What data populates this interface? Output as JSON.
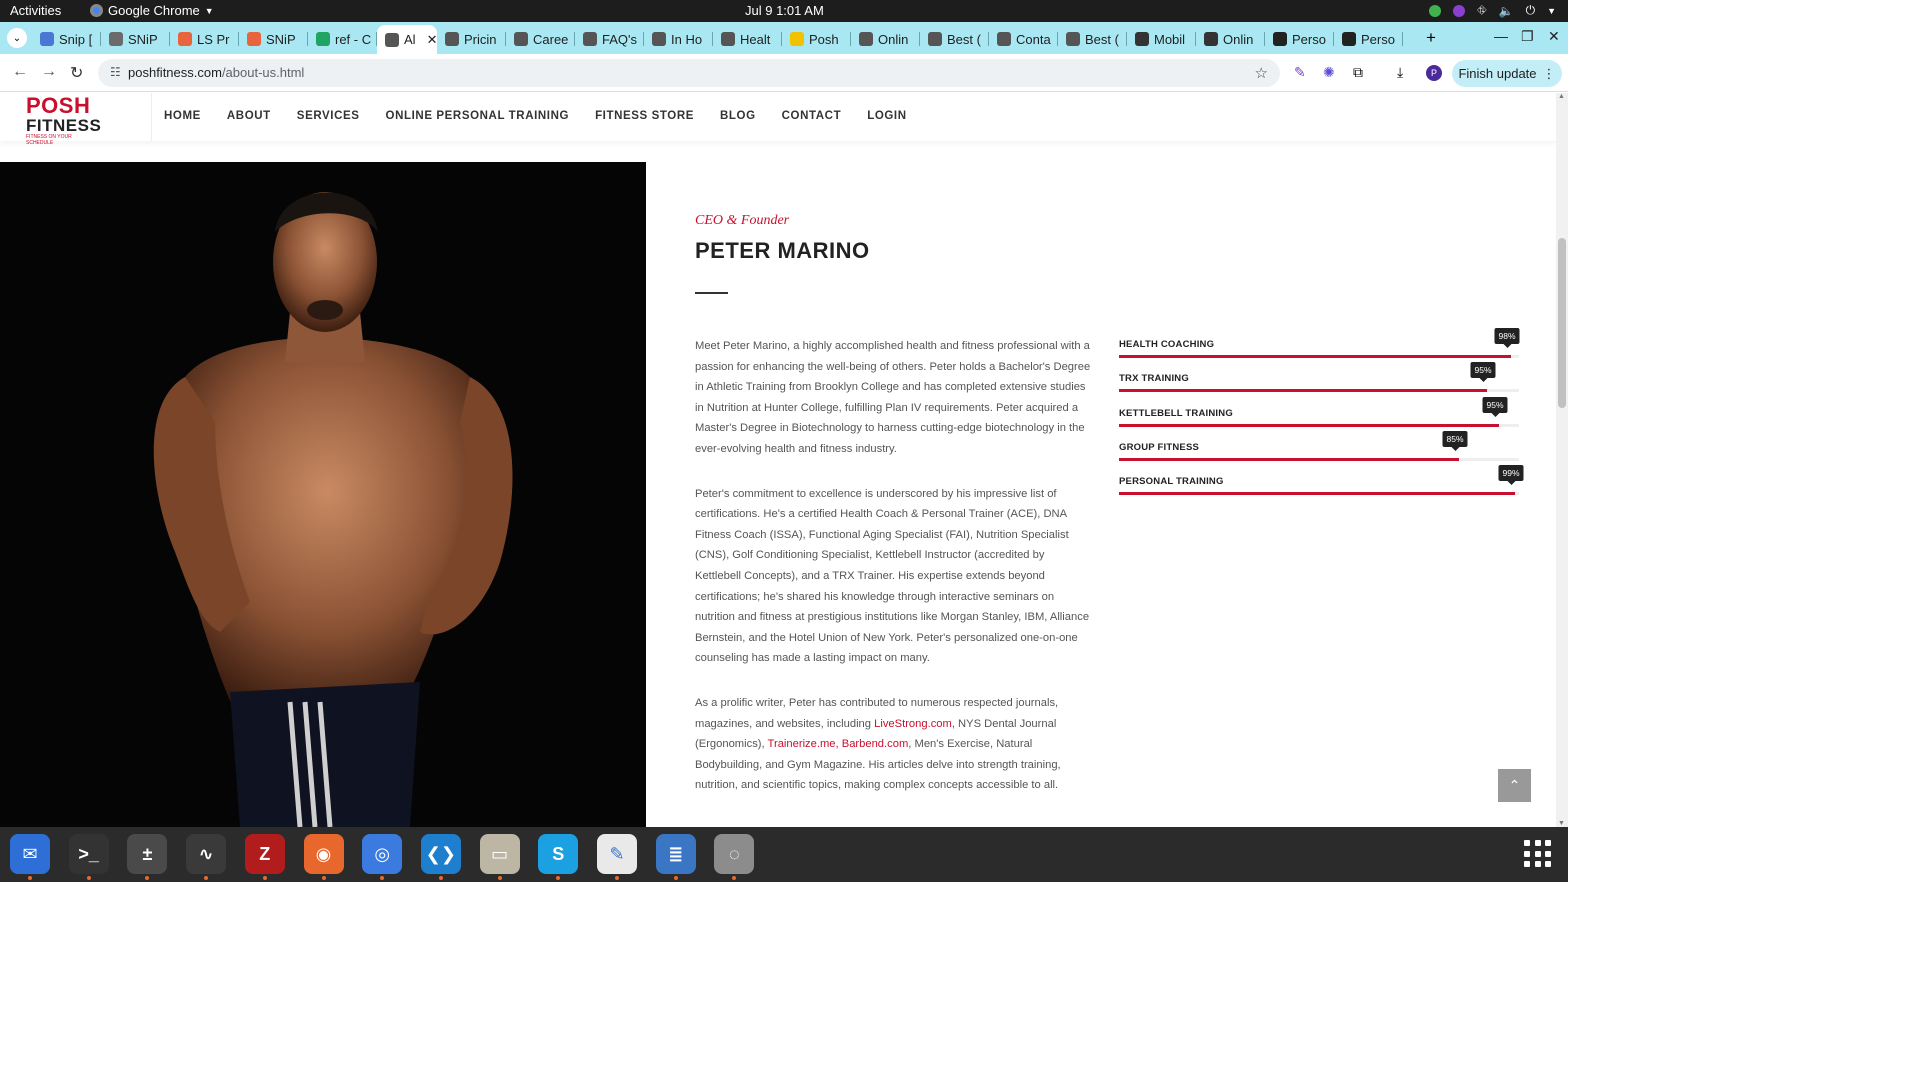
{
  "system": {
    "activities": "Activities",
    "app_name": "Google Chrome",
    "clock": "Jul 9  1:01 AM"
  },
  "tabs": [
    {
      "label": "Snip [",
      "fav_color": "#4a77d4"
    },
    {
      "label": "SNiP",
      "fav_color": "#6b6b6b"
    },
    {
      "label": "LS Pr",
      "fav_color": "#e8643c"
    },
    {
      "label": "SNiP",
      "fav_color": "#e8643c"
    },
    {
      "label": "ref - C",
      "fav_color": "#1fa463"
    },
    {
      "label": "Al",
      "fav_color": "#555555",
      "active": true
    },
    {
      "label": "Pricin",
      "fav_color": "#555555"
    },
    {
      "label": "Caree",
      "fav_color": "#555555"
    },
    {
      "label": "FAQ's",
      "fav_color": "#555555"
    },
    {
      "label": "In Ho",
      "fav_color": "#555555"
    },
    {
      "label": "Healt",
      "fav_color": "#555555"
    },
    {
      "label": "Posh",
      "fav_color": "#f2c200"
    },
    {
      "label": "Onlin",
      "fav_color": "#555555"
    },
    {
      "label": "Best (",
      "fav_color": "#555555"
    },
    {
      "label": "Conta",
      "fav_color": "#555555"
    },
    {
      "label": "Best (",
      "fav_color": "#555555"
    },
    {
      "label": "Mobil",
      "fav_color": "#333333"
    },
    {
      "label": "Onlin",
      "fav_color": "#333333"
    },
    {
      "label": "Perso",
      "fav_color": "#222222"
    },
    {
      "label": "Perso",
      "fav_color": "#222222"
    }
  ],
  "address": {
    "domain": "poshfitness.com",
    "path": "/about-us.html",
    "finish_update": "Finish update"
  },
  "site": {
    "logo_line1": "POSH",
    "logo_line2": "FITNESS",
    "logo_tagline": "FITNESS ON YOUR SCHEDULE",
    "menu": [
      "HOME",
      "ABOUT",
      "SERVICES",
      "ONLINE PERSONAL TRAINING",
      "FITNESS STORE",
      "BLOG",
      "CONTACT",
      "LOGIN"
    ]
  },
  "profile": {
    "role": "CEO & Founder",
    "name": "PETER MARINO",
    "bio_1": "Meet Peter Marino, a highly accomplished health and fitness professional with a passion for enhancing the well-being of others. Peter holds a Bachelor's Degree in Athletic Training from Brooklyn College and has completed extensive studies in Nutrition at Hunter College, fulfilling Plan IV requirements. Peter acquired a Master's Degree in Biotechnology to harness cutting-edge biotechnology in the ever-evolving health and fitness industry.",
    "bio_2": "Peter's commitment to excellence is underscored by his impressive list of certifications. He's a certified Health Coach & Personal Trainer (ACE), DNA Fitness Coach (ISSA), Functional Aging Specialist (FAI), Nutrition Specialist (CNS), Golf Conditioning Specialist, Kettlebell Instructor (accredited by Kettlebell Concepts), and a TRX Trainer. His expertise extends beyond certifications; he's shared his knowledge through interactive seminars on nutrition and fitness at prestigious institutions like Morgan Stanley, IBM, Alliance Bernstein, and the Hotel Union of New York. Peter's personalized one-on-one counseling has made a lasting impact on many.",
    "bio_3_a": "As a prolific writer, Peter has contributed to numerous respected journals, magazines, and websites, including ",
    "bio_3_link1": "LiveStrong.com",
    "bio_3_b": ", NYS Dental Journal (Ergonomics), ",
    "bio_3_link2": "Trainerize.me, Barbend.com",
    "bio_3_c": ", Men's Exercise, Natural Bodybuilding, and Gym Magazine. His articles delve into strength training, nutrition, and scientific topics, making complex concepts accessible to all."
  },
  "skills": [
    {
      "label": "HEALTH COACHING",
      "percent": 98,
      "display": "98%"
    },
    {
      "label": "TRX TRAINING",
      "percent": 92,
      "display": "95%"
    },
    {
      "label": "KETTLEBELL TRAINING",
      "percent": 95,
      "display": "95%"
    },
    {
      "label": "GROUP FITNESS",
      "percent": 85,
      "display": "85%"
    },
    {
      "label": "PERSONAL TRAINING",
      "percent": 99,
      "display": "99%"
    }
  ],
  "colors": {
    "accent": "#c8102e",
    "tab_strip": "#a9e8f3"
  },
  "dock": [
    "thunderbird-icon",
    "terminal-icon",
    "calculator-icon",
    "system-monitor-icon",
    "filezilla-icon",
    "firefox-icon",
    "chrome-icon",
    "vscode-icon",
    "files-icon",
    "skype-icon",
    "text-editor-icon",
    "document-viewer-icon",
    "disks-icon"
  ]
}
